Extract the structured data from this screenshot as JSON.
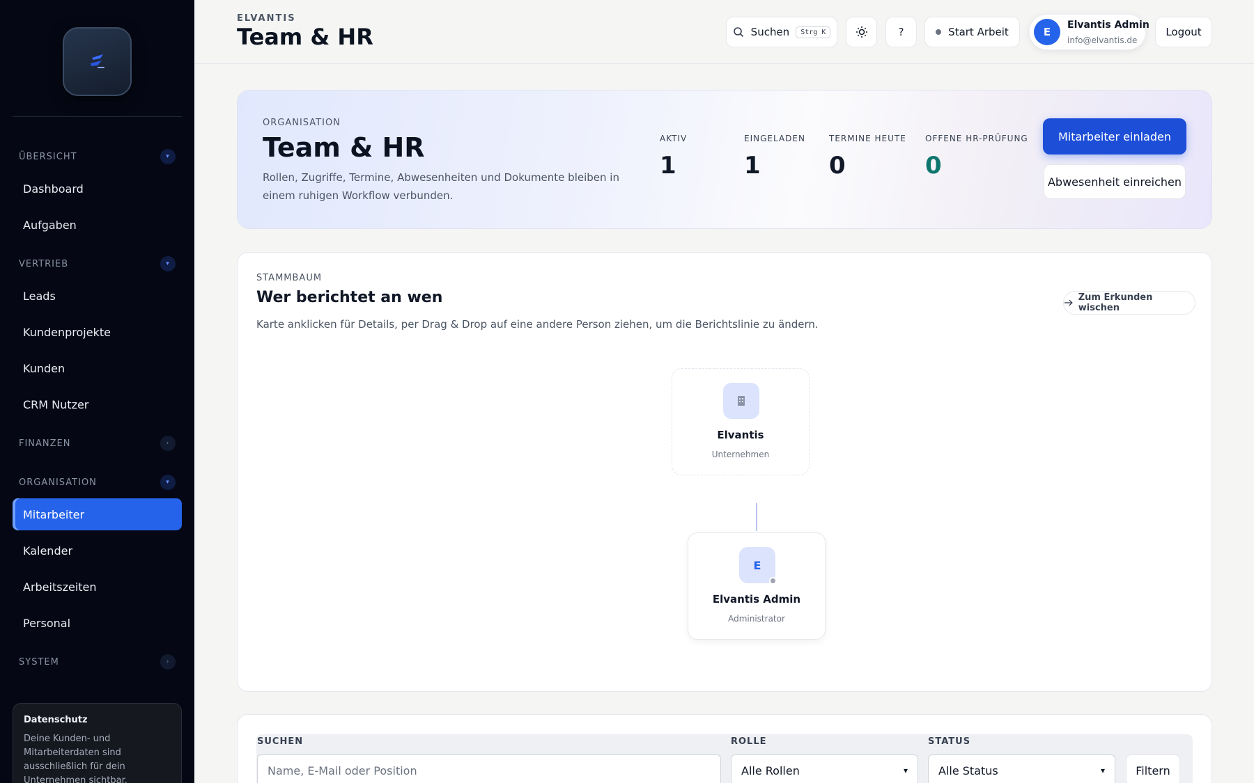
{
  "sidebar": {
    "sections": [
      {
        "label": "ÜBERSICHT",
        "expanded": true,
        "items": [
          "Dashboard",
          "Aufgaben"
        ]
      },
      {
        "label": "VERTRIEB",
        "expanded": true,
        "items": [
          "Leads",
          "Kundenprojekte",
          "Kunden",
          "CRM Nutzer"
        ]
      },
      {
        "label": "FINANZEN",
        "expanded": false,
        "items": []
      },
      {
        "label": "ORGANISATION",
        "expanded": true,
        "items": [
          "Mitarbeiter",
          "Kalender",
          "Arbeitszeiten",
          "Personal"
        ]
      },
      {
        "label": "SYSTEM",
        "expanded": false,
        "items": []
      }
    ],
    "active_item": "Mitarbeiter",
    "privacy": {
      "title": "Datenschutz",
      "text": "Deine Kunden- und Mitarbeiterdaten sind ausschließlich für dein Unternehmen sichtbar."
    }
  },
  "header": {
    "brand": "ELVANTIS",
    "title": "Team & HR",
    "search_label": "Suchen",
    "search_shortcut": "Strg K",
    "theme_icon": "sun-icon",
    "help_label": "?",
    "start_work_label": "Start Arbeit",
    "user": {
      "initial": "E",
      "name": "Elvantis Admin",
      "email": "info@elvantis.de"
    },
    "logout_label": "Logout"
  },
  "hero": {
    "kicker": "ORGANISATION",
    "title": "Team & HR",
    "description": "Rollen, Zugriffe, Termine, Abwesenheiten und Dokumente bleiben in einem ruhigen Workflow verbunden.",
    "stats": [
      {
        "label": "AKTIV",
        "value": "1",
        "color": "#111827"
      },
      {
        "label": "EINGELADEN",
        "value": "1",
        "color": "#111827"
      },
      {
        "label": "TERMINE HEUTE",
        "value": "0",
        "color": "#111827"
      },
      {
        "label": "OFFENE HR-PRÜFUNG",
        "value": "0",
        "color": "#0f766e"
      }
    ],
    "primary_button": "Mitarbeiter einladen",
    "secondary_button": "Abwesenheit einreichen"
  },
  "org_chart": {
    "kicker": "STAMMBAUM",
    "title": "Wer berichtet an wen",
    "description": "Karte anklicken für Details, per Drag & Drop auf eine andere Person ziehen, um die Berichtslinie zu ändern.",
    "explore_button": "Zum Erkunden wischen",
    "root": {
      "icon": "building-icon",
      "name": "Elvantis",
      "role": "Unternehmen"
    },
    "employee": {
      "initial": "E",
      "name": "Elvantis Admin",
      "role": "Administrator"
    }
  },
  "filters": {
    "search_label": "SUCHEN",
    "search_placeholder": "Name, E-Mail oder Position",
    "role_label": "ROLLE",
    "role_value": "Alle Rollen",
    "status_label": "STATUS",
    "status_value": "Alle Status",
    "filter_button": "Filtern"
  },
  "colors": {
    "accent": "#2563eb",
    "sidebar_bg": "#050814",
    "success": "#0f766e"
  }
}
